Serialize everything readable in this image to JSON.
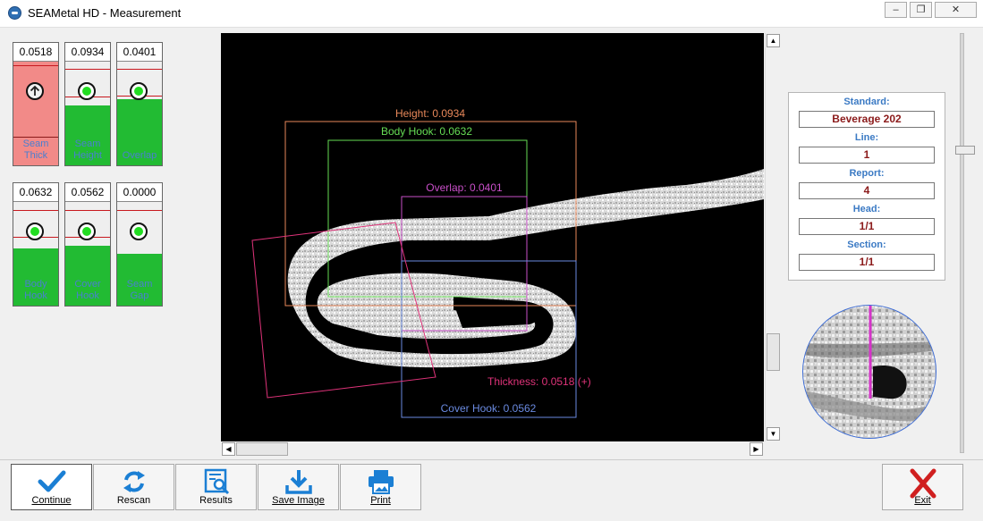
{
  "window": {
    "title": "SEAMetal HD - Measurement"
  },
  "gauges": [
    {
      "id": "seam-thick",
      "value": "0.0518",
      "label": "Seam Thick",
      "status": "out-of-range"
    },
    {
      "id": "seam-height",
      "value": "0.0934",
      "label": "Seam Height",
      "status": "ok"
    },
    {
      "id": "overlap",
      "value": "0.0401",
      "label": "Overlap",
      "status": "ok"
    },
    {
      "id": "body-hook",
      "value": "0.0632",
      "label": "Body Hook",
      "status": "ok"
    },
    {
      "id": "cover-hook",
      "value": "0.0562",
      "label": "Cover Hook",
      "status": "ok"
    },
    {
      "id": "seam-gap",
      "value": "0.0000",
      "label": "Seam Gap",
      "status": "ok"
    }
  ],
  "measurements": {
    "height": "Height: 0.0934",
    "body_hook": "Body Hook: 0.0632",
    "overlap": "Overlap: 0.0401",
    "thickness": "Thickness: 0.0518 (+)",
    "cover_hook": "Cover Hook: 0.0562"
  },
  "info": {
    "standard_label": "Standard:",
    "standard": "Beverage 202",
    "line_label": "Line:",
    "line": "1",
    "report_label": "Report:",
    "report": "4",
    "head_label": "Head:",
    "head": "1/1",
    "section_label": "Section:",
    "section": "1/1"
  },
  "toolbar": {
    "continue": "Continue",
    "rescan": "Rescan",
    "results": "Results",
    "save_image": "Save Image",
    "print": "Print",
    "exit": "Exit"
  },
  "colors": {
    "height": "#e8885a",
    "body_hook": "#66dd55",
    "overlap": "#c94fc9",
    "thickness": "#e0337a",
    "cover_hook": "#6a8ae0",
    "gauge_ok": "#22bb33",
    "gauge_alert": "#f28a88",
    "accent_blue": "#1b7fd4"
  }
}
